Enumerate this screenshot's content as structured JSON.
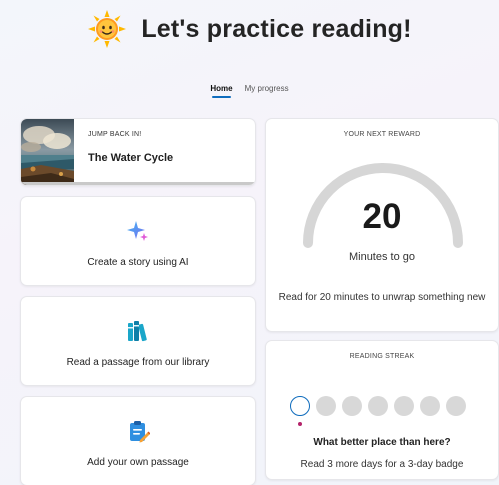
{
  "header": {
    "title": "Let's practice reading!",
    "icon": "sun-icon"
  },
  "tabs": [
    {
      "label": "Home",
      "active": true
    },
    {
      "label": "My progress",
      "active": false
    }
  ],
  "jump_back": {
    "kicker": "JUMP BACK IN!",
    "title": "The Water Cycle"
  },
  "actions": [
    {
      "label": "Create a story using AI",
      "icon": "sparkle-icon"
    },
    {
      "label": "Read a passage from our library",
      "icon": "library-books-icon"
    },
    {
      "label": "Add your own passage",
      "icon": "clipboard-edit-icon"
    }
  ],
  "reward": {
    "kicker": "YOUR NEXT REWARD",
    "minutes": "20",
    "unit_label": "Minutes to go",
    "description": "Read for 20 minutes to unwrap something new"
  },
  "streak": {
    "kicker": "READING STREAK",
    "days_total": 7,
    "current_day": 1,
    "headline": "What better place than here?",
    "description": "Read 3 more days for a 3-day badge"
  },
  "colors": {
    "accent": "#0f6cbd",
    "gauge_track": "#d6d6d6",
    "dot_inactive": "#d8d8d8",
    "today_marker": "#b4236a"
  }
}
